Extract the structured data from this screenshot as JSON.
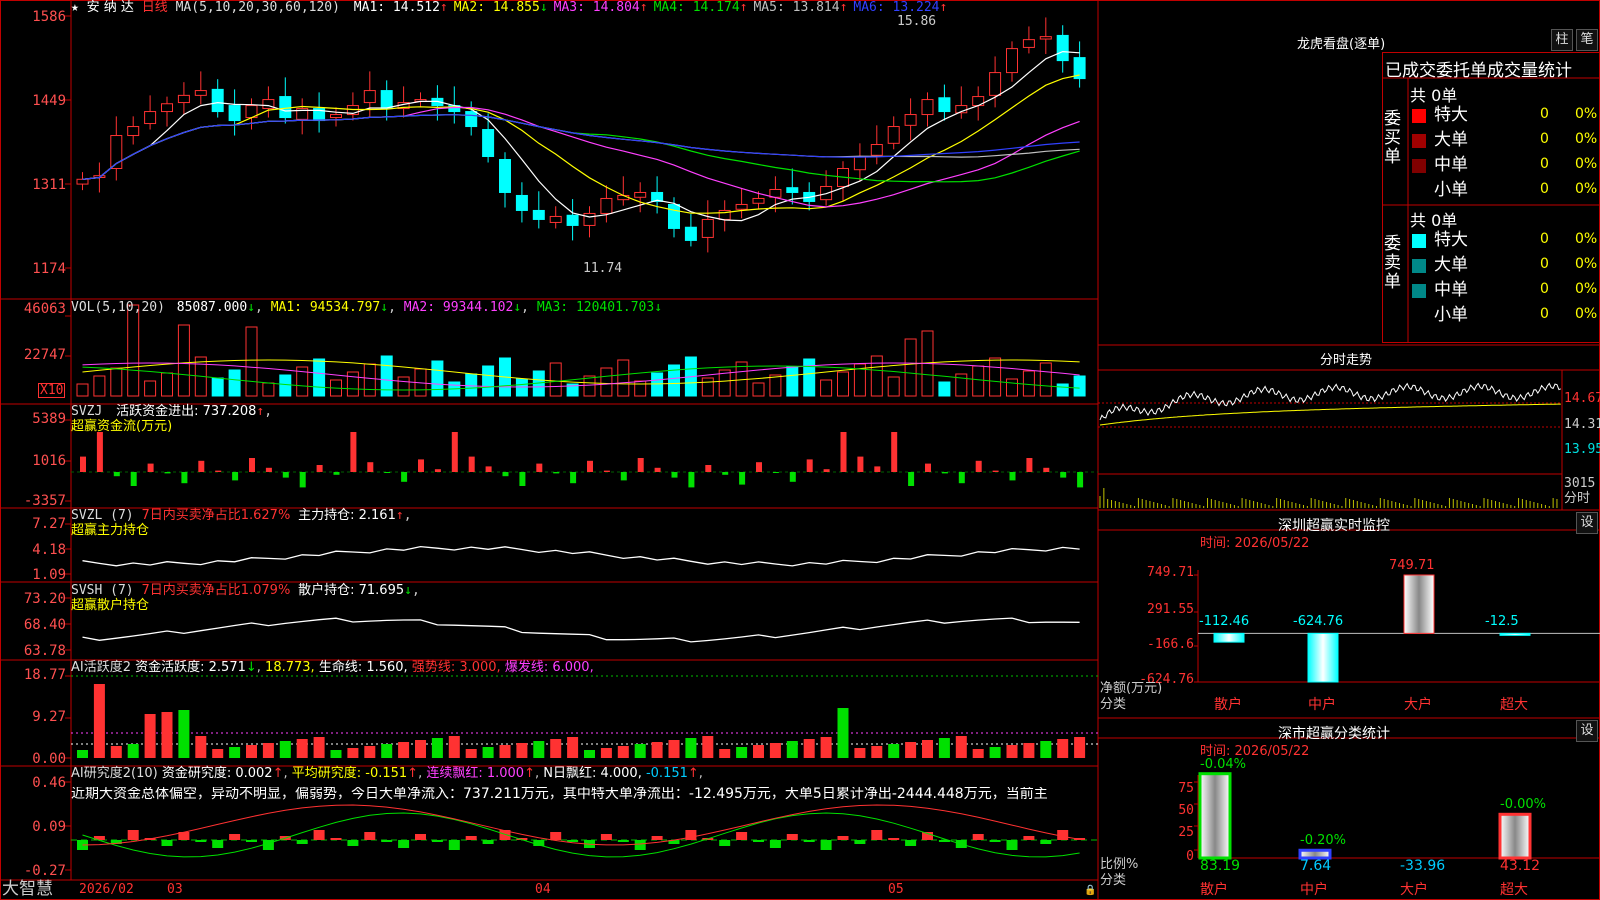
{
  "colors": {
    "up": "#ff3232",
    "down": "#00ffff",
    "bg": "#000000",
    "border": "#c00000",
    "green": "#00e000",
    "magenta": "#ff40ff",
    "yellow": "#ffff00"
  },
  "price_panel": {
    "star": "★",
    "name": "安 纳 达",
    "period": "日线",
    "ma_params": "MA(5,10,20,30,60,120)",
    "mas": [
      {
        "label": "MA1: 14.512",
        "arrow": "↑",
        "color": "#ffffff"
      },
      {
        "label": "MA2: 14.855",
        "arrow": "↓",
        "color": "#ffff00"
      },
      {
        "label": "MA3: 14.804",
        "arrow": "↑",
        "color": "#ff40ff"
      },
      {
        "label": "MA4: 14.174",
        "arrow": "↑",
        "color": "#00e000"
      },
      {
        "label": "MA5: 13.814",
        "arrow": "↑",
        "color": "#c0c0c0"
      },
      {
        "label": "MA6: 13.224",
        "arrow": "↑",
        "color": "#3040ff"
      }
    ],
    "yticks": [
      "1586",
      "1449",
      "1311",
      "1174"
    ],
    "high_label": "15.86",
    "low_label": "11.74"
  },
  "vol_panel": {
    "title": "VOL(5,10,20)",
    "value": "85087.000",
    "v_arrow": "↓",
    "ma1": "MA1: 94534.797",
    "ma1_arrow": "↓",
    "ma2": "MA2: 99344.102",
    "ma2_arrow": "↓",
    "ma3": "MA3: 120401.703",
    "ma3_arrow": "↓",
    "yticks": [
      "46063",
      "22747"
    ],
    "unit": "X10"
  },
  "svzj_panel": {
    "title": "SVZJ",
    "line1": "活跃资金进出: 737.208",
    "line1_arrow": "↑",
    "line2": "超赢资金流(万元)",
    "yticks": [
      "5389",
      "1016",
      "-3357"
    ]
  },
  "svzl_panel": {
    "title": "SVZL (7)",
    "t1": "7日内买卖净占比1.627%",
    "t2": "主力持仓: 2.161",
    "t2_arrow": "↑",
    "line2": "超赢主力持仓",
    "yticks": [
      "7.27",
      "4.18",
      "1.09"
    ]
  },
  "svsh_panel": {
    "title": "SVSH (7)",
    "t1": "7日内买卖净占比1.079%",
    "t2": "散户持仓: 71.695",
    "t2_arrow": "↓",
    "line2": "超赢散户持仓",
    "yticks": [
      "73.20",
      "68.40",
      "63.78"
    ]
  },
  "ai_active": {
    "title": "AI活跃度2",
    "t1": "资金活跃度: 2.571",
    "t1_arrow": "↓",
    "t2": "18.773,",
    "t3": "生命线: 1.560,",
    "t4": "强势线: 3.000,",
    "t5": "爆发线: 6.000,",
    "yticks": [
      "18.77",
      "9.27",
      "0.00"
    ]
  },
  "ai_research": {
    "title": "AI研究度2(10)",
    "t1": "资金研究度: 0.002",
    "t1_arrow": "↑",
    "t2": "平均研究度: -0.151",
    "t2_arrow": "↑",
    "t3": "连续飘红: 1.000",
    "t3_arrow": "↑",
    "t4": "N日飘红: 4.000,",
    "t5": "-0.151",
    "t5_arrow": "↑",
    "comment": "近期大资金总体偏空，异动不明显，偏弱势，今日大单净流入：737.211万元，其中特大单净流出：-12.495万元，大单5日累计净出-2444.448万元，当前主",
    "yticks": [
      "0.46",
      "0.09",
      "-0.27"
    ]
  },
  "x_axis": {
    "brand": "大智慧",
    "labels": [
      "2026/02",
      "03",
      "04",
      "05"
    ]
  },
  "lhb": {
    "title": "龙虎看盘(逐单)",
    "btn1": "柱",
    "btn2": "笔",
    "tab_title": "已成交委托单成交量统计",
    "buy_side": "委买单",
    "sell_side": "委卖单",
    "buy_total": "共 0单",
    "sell_total": "共 0单",
    "buy_rows": [
      {
        "label": "特大",
        "count": "0",
        "pct": "0%",
        "color": "#ff0000"
      },
      {
        "label": "大单",
        "count": "0",
        "pct": "0%",
        "color": "#a00000"
      },
      {
        "label": "中单",
        "count": "0",
        "pct": "0%",
        "color": "#800000"
      },
      {
        "label": "小单",
        "count": "0",
        "pct": "0%",
        "color": ""
      }
    ],
    "sell_rows": [
      {
        "label": "特大",
        "count": "0",
        "pct": "0%",
        "color": "#00ffff"
      },
      {
        "label": "大单",
        "count": "0",
        "pct": "0%",
        "color": "#008888"
      },
      {
        "label": "中单",
        "count": "0",
        "pct": "0%",
        "color": "#008888"
      },
      {
        "label": "小单",
        "count": "0",
        "pct": "0%",
        "color": ""
      }
    ]
  },
  "intraday": {
    "title": "分时走势",
    "ticks": [
      "14.67",
      "14.31",
      "13.95"
    ],
    "vol": "3015",
    "vol_unit": "分时"
  },
  "sz_monitor": {
    "title": "深圳超赢实时监控",
    "btn": "设",
    "time": "时间: 2026/05/22",
    "yticks": [
      "749.71",
      "291.55",
      "-166.6",
      "-624.76"
    ],
    "ylabel1": "净额(万元)",
    "ylabel2": "分类",
    "chart_data": {
      "type": "bar",
      "categories": [
        "散户",
        "中户",
        "大户",
        "超大"
      ],
      "values": [
        -112.46,
        -624.76,
        749.71,
        -12.5
      ],
      "labels": [
        "-112.46",
        "-624.76",
        "749.71",
        "-12.5"
      ],
      "ylim": [
        -624.76,
        749.71
      ]
    }
  },
  "sz_class": {
    "title": "深市超赢分类统计",
    "btn": "设",
    "time": "时间: 2026/05/22",
    "yticks": [
      "75",
      "50",
      "25",
      "0"
    ],
    "ylabel1": "比例%",
    "ylabel2": "分类",
    "chart_data": {
      "type": "bar",
      "categories": [
        "散户",
        "中户",
        "大户",
        "超大"
      ],
      "values": [
        83.19,
        7.64,
        0,
        43.12
      ],
      "top_labels": [
        "-0.04%",
        "-0.20%",
        "",
        "-0.00%"
      ],
      "bottom_labels": [
        "83.19",
        "7.64",
        "-33.96",
        "43.12"
      ],
      "ylim": [
        0,
        100
      ]
    }
  }
}
